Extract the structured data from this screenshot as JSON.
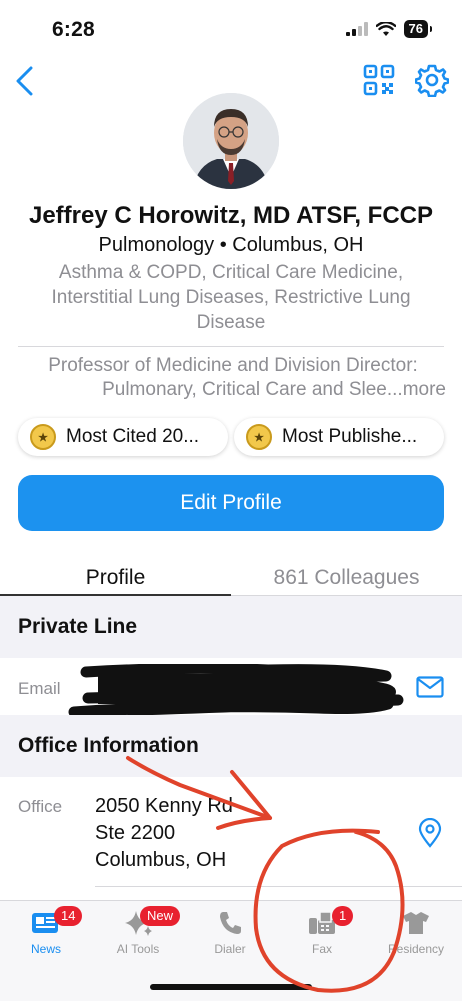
{
  "status_bar": {
    "time": "6:28",
    "battery": "76"
  },
  "header": {
    "back_icon": "chevron-left-icon",
    "qr_icon": "qr-code-icon",
    "settings_icon": "gear-icon"
  },
  "profile": {
    "name": "Jeffrey C Horowitz, MD ATSF, FCCP",
    "specialty": "Pulmonology",
    "location": "Columbus, OH",
    "separator": "•",
    "specialties_line1": "Asthma & COPD, Critical Care Medicine,",
    "specialties_line2": "Interstitial Lung Diseases, Restrictive Lung",
    "specialties_line3": "Disease",
    "bio_line1": "Professor of Medicine and Division Director:",
    "bio_line2": "Pulmonary, Critical Care and Slee",
    "bio_more": "...more"
  },
  "chips": [
    {
      "label": "Most Cited 20...",
      "icon": "medal-icon"
    },
    {
      "label": "Most Publishe...",
      "icon": "medal-icon"
    }
  ],
  "edit_profile_label": "Edit Profile",
  "tabs": [
    {
      "label": "Profile",
      "active": true
    },
    {
      "label": "861 Colleagues",
      "active": false
    }
  ],
  "private_line": {
    "title": "Private Line",
    "email_label": "Email"
  },
  "office_info": {
    "title": "Office Information",
    "office_label": "Office",
    "address_line1": "2050 Kenny Rd",
    "address_line2": "Ste 2200",
    "address_line3": "Columbus, OH"
  },
  "tabbar": [
    {
      "label": "News",
      "icon": "news-icon",
      "badge": "14",
      "active": true
    },
    {
      "label": "AI Tools",
      "icon": "sparkle-icon",
      "badge": "New",
      "active": false
    },
    {
      "label": "Dialer",
      "icon": "phone-icon",
      "badge": "",
      "active": false
    },
    {
      "label": "Fax",
      "icon": "fax-icon",
      "badge": "1",
      "active": false
    },
    {
      "label": "Residency",
      "icon": "shirt-icon",
      "badge": "",
      "active": false
    }
  ],
  "colors": {
    "accent": "#1c92ef",
    "badge": "#e8212f",
    "annotation": "#e0432b"
  }
}
